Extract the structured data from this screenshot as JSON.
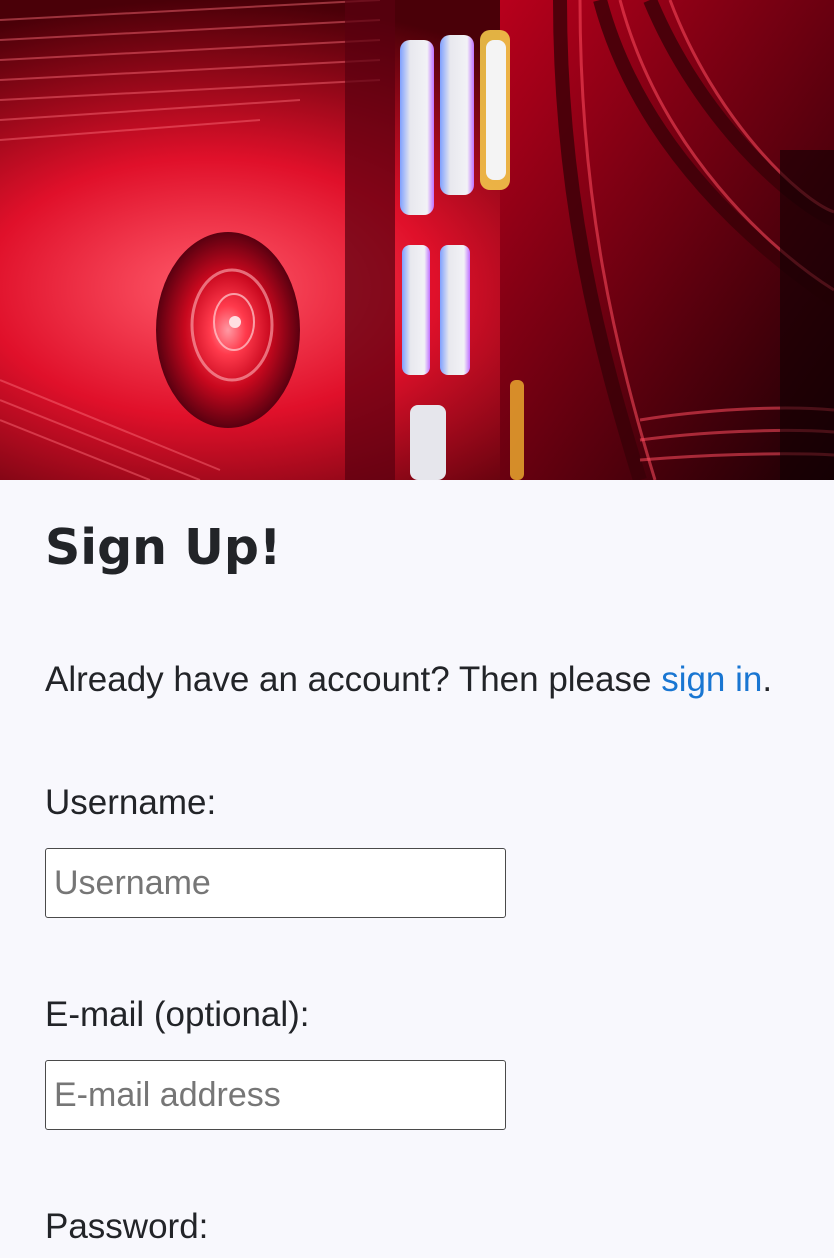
{
  "hero": {
    "image": "computer-hardware-red-lighting"
  },
  "signup": {
    "title": "Sign Up!",
    "lead_text": "Already have an account? Then please ",
    "signin_link": "sign in",
    "lead_end": "."
  },
  "form": {
    "username": {
      "label": "Username:",
      "placeholder": "Username",
      "value": ""
    },
    "email": {
      "label": "E-mail (optional):",
      "placeholder": "E-mail address",
      "value": ""
    },
    "password": {
      "label": "Password:"
    }
  },
  "colors": {
    "link": "#1976d2",
    "background": "#f8f8fd",
    "text": "#222428"
  }
}
